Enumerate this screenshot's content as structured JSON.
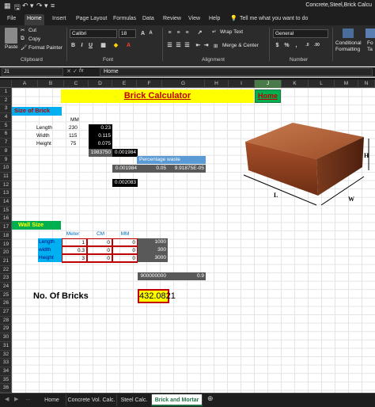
{
  "titlebar": {
    "file_icon": "excel-icon",
    "document_title": "Concrete,Steel,Brick Calcu"
  },
  "ribbon_tabs": [
    "File",
    "Home",
    "Insert",
    "Page Layout",
    "Formulas",
    "Data",
    "Review",
    "View",
    "Help"
  ],
  "tell_me": "Tell me what you want to do",
  "ribbon": {
    "clipboard": {
      "paste": "Paste",
      "cut": "Cut",
      "copy": "Copy",
      "format_painter": "Format Painter",
      "group_label": "Clipboard"
    },
    "font": {
      "name": "Calibri",
      "size": "18",
      "bold": "B",
      "italic": "I",
      "underline": "U",
      "group_label": "Font"
    },
    "alignment": {
      "wrap_text": "Wrap Text",
      "merge_center": "Merge & Center",
      "group_label": "Alignment"
    },
    "number": {
      "format": "General",
      "group_label": "Number"
    },
    "styles": {
      "conditional": "Conditional",
      "formatting": "Formatting",
      "format_table": "Fo",
      "format_table2": "Ta"
    }
  },
  "formula_bar": {
    "name_box": "J1",
    "fx": "fx",
    "value": "Home"
  },
  "columns": [
    "A",
    "B",
    "C",
    "D",
    "E",
    "F",
    "G",
    "H",
    "I",
    "J",
    "K",
    "L",
    "M",
    "N"
  ],
  "rows": [
    "1",
    "2",
    "3",
    "4",
    "5",
    "6",
    "7",
    "8",
    "9",
    "10",
    "11",
    "12",
    "13",
    "14",
    "15",
    "16",
    "17",
    "18",
    "19",
    "20",
    "21",
    "22",
    "23",
    "24",
    "25",
    "26",
    "27",
    "28",
    "29",
    "30",
    "31",
    "32",
    "33",
    "34",
    "35",
    "36"
  ],
  "sheet": {
    "title": "Brick Calculator",
    "home_link": "Home",
    "size_header": "Size of Brick",
    "mm_label": "MM",
    "length_label": "Length",
    "width_label": "Width",
    "height_label": "Height",
    "length_mm": "230",
    "width_mm": "115",
    "height_mm": "75",
    "length_m": "0.23",
    "width_m": "0.115",
    "height_m": "0.075",
    "volume_mm": "1983750",
    "volume_m": "0.001984",
    "pct_waste_label": "Percentage waste",
    "waste_base": "0.001984",
    "waste_pct": "0.05",
    "waste_value": "9.91875E-05",
    "brick_with_waste": "0.002083",
    "wall_header": "Wall Size",
    "meter_label": "Meter",
    "cm_label": "CM",
    "mm_col_label": "MM",
    "wall_length_label": "Length",
    "wall_width_label": "width",
    "wall_height_label": "Height",
    "wall_length_m": "1",
    "wall_width_m": "0.3",
    "wall_height_m": "3",
    "wall_length_cm": "0",
    "wall_width_cm": "0",
    "wall_height_cm": "0",
    "wall_length_mm": "0",
    "wall_width_mm": "0",
    "wall_height_mm": "0",
    "wall_length_total": "1000",
    "wall_width_total": "300",
    "wall_height_total": "3000",
    "wall_volume_mm": "900000000",
    "wall_volume_m": "0.9",
    "bricks_label": "No. Of Bricks",
    "bricks_value": "432.0821"
  },
  "brick_image": {
    "length_label": "L",
    "width_label": "W",
    "height_label": "H"
  },
  "sheet_tabs": [
    "Home",
    "Concrete Vol. Calc.",
    "Steel Calc.",
    "Brick and Mortar"
  ],
  "active_sheet": "Brick and Mortar",
  "colors": {
    "title_yellow": "#ffff00",
    "header_cyan": "#00b0f0",
    "wall_green": "#00b050",
    "accent_excel": "#217346",
    "bricks_orange_border": "#c00000"
  }
}
